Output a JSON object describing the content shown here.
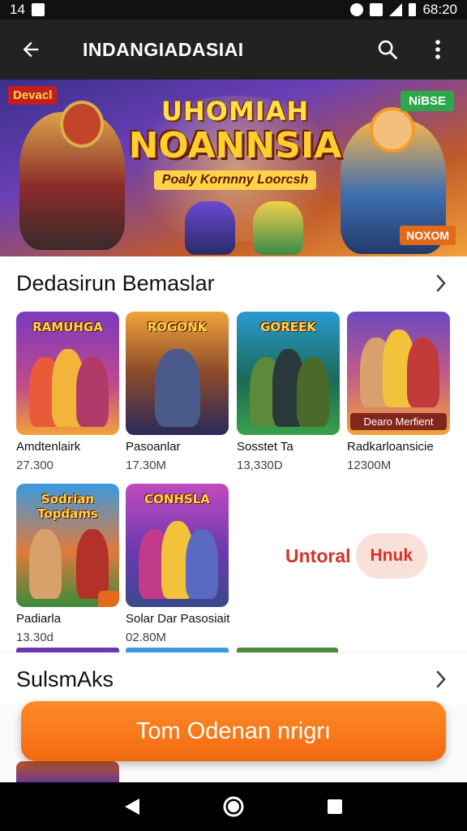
{
  "status_bar": {
    "time_left": "14",
    "time_right": "68:20"
  },
  "app_bar": {
    "title": "INDANGIADASIAI",
    "back_icon": "arrow-back-icon",
    "search_icon": "search-icon",
    "menu_icon": "more-vert-icon"
  },
  "banner": {
    "badge_left": "Devacl",
    "badge_right": "NiBSE",
    "badge_bottom_right": "NOXOM",
    "title_line1": "UHOMIAH",
    "title_line2": "NOANNSIA",
    "subtitle": "Poaly Kornnny Loorcsh"
  },
  "section1": {
    "title": "Dedasirun Bemaslar",
    "items": [
      {
        "thumb_title": "RAMUHGA",
        "name": "Amdtenlairk",
        "size": "27.300"
      },
      {
        "thumb_title": "ROGONK",
        "name": "Pasoanlar",
        "size": "17.30M"
      },
      {
        "thumb_title": "GOREEK",
        "name": "Sosstet Ta",
        "size": "13,330D"
      },
      {
        "thumb_title": "",
        "thumb_banner": "Dearo Merfient",
        "name": "Radkarloansicie",
        "size": "12300M"
      },
      {
        "thumb_title": "Sodrian Topdams",
        "name": "Padiarla",
        "size": "13.30d"
      },
      {
        "thumb_title": "CONHSLA",
        "name": "Solar Dar Pasosiait",
        "size": "02.80M"
      }
    ],
    "promo_text": "Untoral",
    "promo_pill": "Hnuk"
  },
  "section2": {
    "title": "SulsmAks"
  },
  "cta": {
    "label": "Tom Odenan nrigrı"
  },
  "nav": {
    "back": "nav-back-icon",
    "home": "nav-home-icon",
    "recents": "nav-recents-icon"
  },
  "colors": {
    "accent": "#f26a10",
    "appbar": "#222222",
    "promo_red": "#d4322a"
  }
}
